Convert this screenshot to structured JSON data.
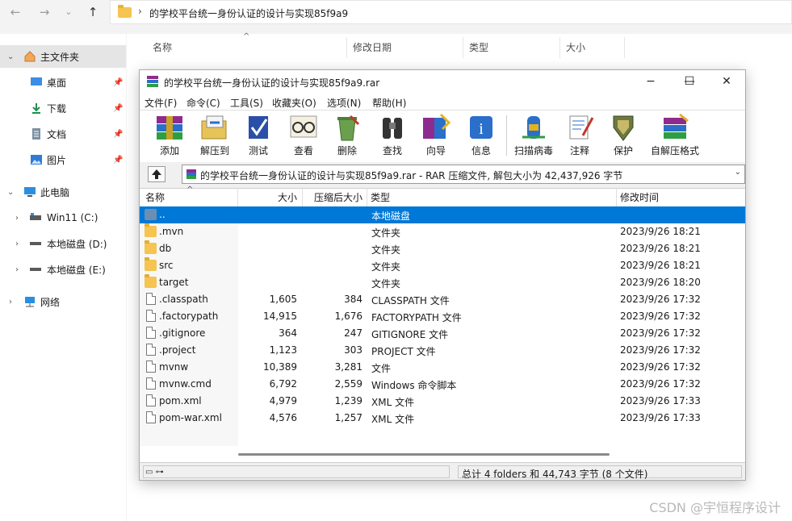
{
  "explorer": {
    "address": "的学校平台统一身份认证的设计与实现85f9a9",
    "columns": [
      "名称",
      "修改日期",
      "类型",
      "大小"
    ],
    "sidebar": [
      {
        "label": "主文件夹",
        "icon": "home-icon",
        "selected": true
      },
      {
        "label": "桌面",
        "icon": "desktop-icon",
        "pinned": true
      },
      {
        "label": "下载",
        "icon": "download-icon",
        "pinned": true
      },
      {
        "label": "文档",
        "icon": "document-icon",
        "pinned": true
      },
      {
        "label": "图片",
        "icon": "picture-icon",
        "pinned": true
      },
      {
        "label": "此电脑",
        "icon": "pc-icon"
      },
      {
        "label": "Win11 (C:)",
        "icon": "drive-icon"
      },
      {
        "label": "本地磁盘 (D:)",
        "icon": "drive-icon"
      },
      {
        "label": "本地磁盘 (E:)",
        "icon": "drive-icon"
      },
      {
        "label": "网络",
        "icon": "network-icon"
      }
    ]
  },
  "rar": {
    "title": "的学校平台统一身份认证的设计与实现85f9a9.rar",
    "menu": [
      "文件(F)",
      "命令(C)",
      "工具(S)",
      "收藏夹(O)",
      "选项(N)",
      "帮助(H)"
    ],
    "tools": [
      "添加",
      "解压到",
      "测试",
      "查看",
      "删除",
      "查找",
      "向导",
      "信息",
      "扫描病毒",
      "注释",
      "保护",
      "自解压格式"
    ],
    "path": "的学校平台统一身份认证的设计与实现85f9a9.rar - RAR 压缩文件, 解包大小为 42,437,926 字节",
    "columns": {
      "name": "名称",
      "size": "大小",
      "packed": "压缩后大小",
      "type": "类型",
      "modified": "修改时间"
    },
    "files": [
      {
        "name": "..",
        "size": "",
        "packed": "",
        "type": "本地磁盘",
        "modified": "",
        "kind": "updir",
        "selected": true
      },
      {
        "name": ".mvn",
        "size": "",
        "packed": "",
        "type": "文件夹",
        "modified": "2023/9/26 18:21",
        "kind": "folder"
      },
      {
        "name": "db",
        "size": "",
        "packed": "",
        "type": "文件夹",
        "modified": "2023/9/26 18:21",
        "kind": "folder"
      },
      {
        "name": "src",
        "size": "",
        "packed": "",
        "type": "文件夹",
        "modified": "2023/9/26 18:21",
        "kind": "folder"
      },
      {
        "name": "target",
        "size": "",
        "packed": "",
        "type": "文件夹",
        "modified": "2023/9/26 18:20",
        "kind": "folder"
      },
      {
        "name": ".classpath",
        "size": "1,605",
        "packed": "384",
        "type": "CLASSPATH 文件",
        "modified": "2023/9/26 17:32",
        "kind": "file"
      },
      {
        "name": ".factorypath",
        "size": "14,915",
        "packed": "1,676",
        "type": "FACTORYPATH 文件",
        "modified": "2023/9/26 17:32",
        "kind": "file"
      },
      {
        "name": ".gitignore",
        "size": "364",
        "packed": "247",
        "type": "GITIGNORE 文件",
        "modified": "2023/9/26 17:32",
        "kind": "file"
      },
      {
        "name": ".project",
        "size": "1,123",
        "packed": "303",
        "type": "PROJECT 文件",
        "modified": "2023/9/26 17:32",
        "kind": "file"
      },
      {
        "name": "mvnw",
        "size": "10,389",
        "packed": "3,281",
        "type": "文件",
        "modified": "2023/9/26 17:32",
        "kind": "file"
      },
      {
        "name": "mvnw.cmd",
        "size": "6,792",
        "packed": "2,559",
        "type": "Windows 命令脚本",
        "modified": "2023/9/26 17:32",
        "kind": "script"
      },
      {
        "name": "pom.xml",
        "size": "4,979",
        "packed": "1,239",
        "type": "XML 文件",
        "modified": "2023/9/26 17:33",
        "kind": "file"
      },
      {
        "name": "pom-war.xml",
        "size": "4,576",
        "packed": "1,257",
        "type": "XML 文件",
        "modified": "2023/9/26 17:33",
        "kind": "file"
      }
    ],
    "status": "总计 4 folders 和 44,743 字节 (8 个文件)"
  },
  "watermark": "CSDN @宇恒程序设计"
}
